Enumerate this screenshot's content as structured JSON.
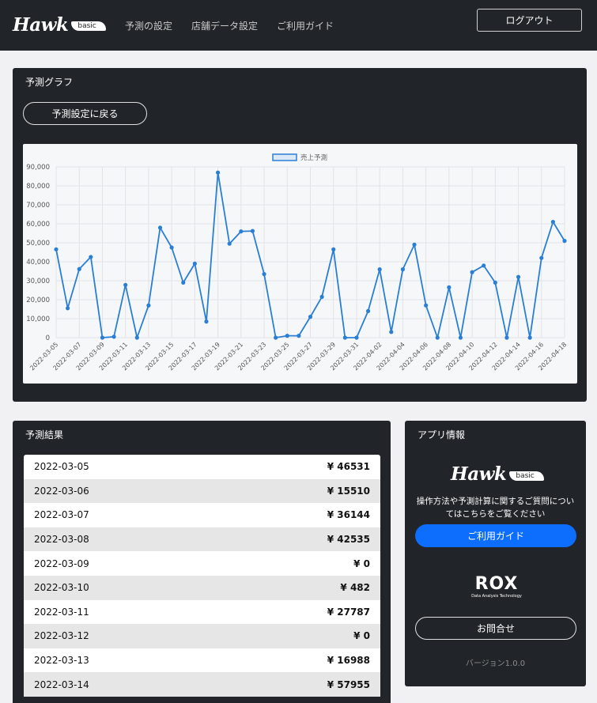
{
  "navbar": {
    "brand": "Hawk",
    "brand_badge": "basic",
    "links": [
      "予測の設定",
      "店舗データ設定",
      "ご利用ガイド"
    ],
    "logout_label": "ログアウト"
  },
  "graph_panel": {
    "title": "予測グラフ",
    "back_button": "予測設定に戻る"
  },
  "chart_data": {
    "type": "line",
    "title": "",
    "xlabel": "",
    "ylabel": "",
    "legend_position": "top-center",
    "grid": true,
    "ylim": [
      0,
      90000
    ],
    "yticks": [
      "0",
      "10,000",
      "20,000",
      "30,000",
      "40,000",
      "50,000",
      "60,000",
      "70,000",
      "80,000",
      "90,000"
    ],
    "x": [
      "2022-03-05",
      "2022-03-06",
      "2022-03-07",
      "2022-03-08",
      "2022-03-09",
      "2022-03-10",
      "2022-03-11",
      "2022-03-12",
      "2022-03-13",
      "2022-03-14",
      "2022-03-15",
      "2022-03-16",
      "2022-03-17",
      "2022-03-18",
      "2022-03-19",
      "2022-03-20",
      "2022-03-21",
      "2022-03-22",
      "2022-03-23",
      "2022-03-24",
      "2022-03-25",
      "2022-03-26",
      "2022-03-27",
      "2022-03-28",
      "2022-03-29",
      "2022-03-30",
      "2022-03-31",
      "2022-04-01",
      "2022-04-02",
      "2022-04-03",
      "2022-04-04",
      "2022-04-05",
      "2022-04-06",
      "2022-04-07",
      "2022-04-08",
      "2022-04-09",
      "2022-04-10",
      "2022-04-11",
      "2022-04-12",
      "2022-04-13",
      "2022-04-14",
      "2022-04-15",
      "2022-04-16",
      "2022-04-17",
      "2022-04-18"
    ],
    "xtick_labels": [
      "2022-03-05",
      "2022-03-07",
      "2022-03-09",
      "2022-03-11",
      "2022-03-13",
      "2022-03-15",
      "2022-03-17",
      "2022-03-19",
      "2022-03-21",
      "2022-03-23",
      "2022-03-25",
      "2022-03-27",
      "2022-03-29",
      "2022-03-31",
      "2022-04-02",
      "2022-04-04",
      "2022-04-06",
      "2022-04-08",
      "2022-04-10",
      "2022-04-12",
      "2022-04-14",
      "2022-04-16",
      "2022-04-18"
    ],
    "series": [
      {
        "name": "売上予測",
        "color": "#2a7fd4",
        "values": [
          46531,
          15510,
          36144,
          42535,
          0,
          482,
          27787,
          0,
          16988,
          57955,
          47500,
          29000,
          39000,
          8500,
          87000,
          49500,
          56000,
          56200,
          33500,
          0,
          1000,
          1000,
          11000,
          21500,
          46500,
          0,
          0,
          14000,
          36000,
          3000,
          36000,
          49000,
          17000,
          0,
          26500,
          0,
          34500,
          38000,
          29000,
          0,
          32000,
          0,
          42000,
          61000,
          51000
        ]
      }
    ]
  },
  "results_panel": {
    "title": "予測結果",
    "rows": [
      {
        "date": "2022-03-05",
        "amount": "¥ 46531"
      },
      {
        "date": "2022-03-06",
        "amount": "¥ 15510"
      },
      {
        "date": "2022-03-07",
        "amount": "¥ 36144"
      },
      {
        "date": "2022-03-08",
        "amount": "¥ 42535"
      },
      {
        "date": "2022-03-09",
        "amount": "¥ 0"
      },
      {
        "date": "2022-03-10",
        "amount": "¥ 482"
      },
      {
        "date": "2022-03-11",
        "amount": "¥ 27787"
      },
      {
        "date": "2022-03-12",
        "amount": "¥ 0"
      },
      {
        "date": "2022-03-13",
        "amount": "¥ 16988"
      },
      {
        "date": "2022-03-14",
        "amount": "¥ 57955"
      }
    ]
  },
  "info_panel": {
    "title": "アプリ情報",
    "logo": "Hawk",
    "logo_badge": "basic",
    "description": "操作方法や予測計算に関するご質問についてはこちらをご覧ください",
    "guide_button": "ご利用ガイド",
    "company_logo": "ROX",
    "company_tagline": "Data Analysis Technology",
    "contact_button": "お問合せ",
    "version": "バージョン1.0.0"
  }
}
